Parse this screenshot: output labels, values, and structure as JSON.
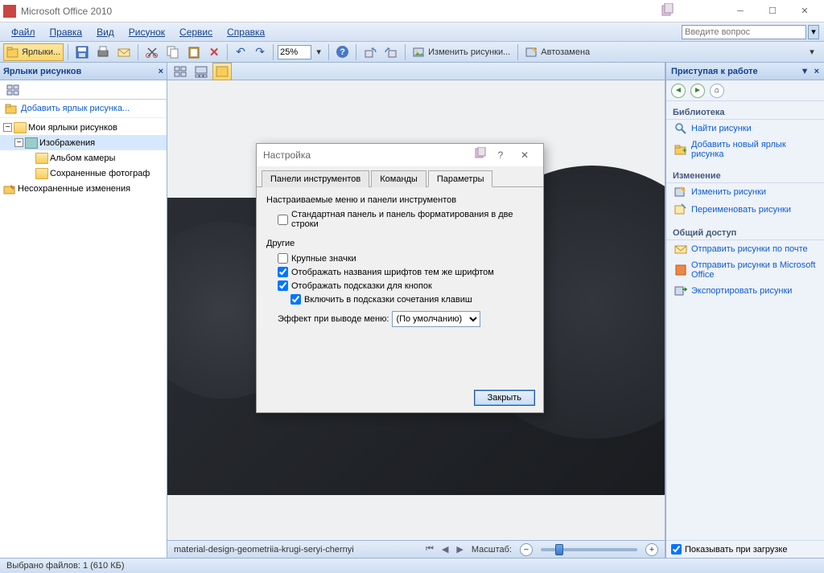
{
  "titlebar": {
    "title": "Microsoft Office 2010"
  },
  "menus": {
    "file": "Файл",
    "edit": "Правка",
    "view": "Вид",
    "picture": "Рисунок",
    "tools": "Сервис",
    "help": "Справка",
    "help_search_placeholder": "Введите вопрос"
  },
  "toolbar": {
    "shortcuts_label": "Ярлыки...",
    "zoom_value": "25%",
    "edit_pictures_label": "Изменить рисунки...",
    "autocorrect_label": "Автозамена"
  },
  "left_panel": {
    "title": "Ярлыки рисунков",
    "add_shortcut": "Добавить ярлык рисунка...",
    "tree": {
      "my_shortcuts": "Мои ярлыки рисунков",
      "images": "Изображения",
      "camera_album": "Альбом камеры",
      "saved_photos": "Сохраненные фотограф",
      "unsaved_changes": "Несохраненные изменения"
    }
  },
  "center": {
    "filename": "material-design-geometriia-krugi-seryi-chernyi",
    "zoom_label": "Масштаб:"
  },
  "right_panel": {
    "title": "Приступая к работе",
    "sections": {
      "library": "Библиотека",
      "edit": "Изменение",
      "share": "Общий доступ"
    },
    "links": {
      "find_pictures": "Найти рисунки",
      "add_new_shortcut": "Добавить новый ярлык рисунка",
      "edit_pictures": "Изменить рисунки",
      "rename_pictures": "Переименовать рисунки",
      "send_email": "Отправить рисунки по почте",
      "send_office": "Отправить рисунки в Microsoft Office",
      "export": "Экспортировать рисунки"
    },
    "show_on_load": "Показывать при загрузке"
  },
  "statusbar": {
    "selected": "Выбрано файлов: 1 (610 КБ)"
  },
  "dialog": {
    "title": "Настройка",
    "tabs": {
      "toolbars": "Панели инструментов",
      "commands": "Команды",
      "options": "Параметры"
    },
    "body": {
      "group1_title": "Настраиваемые меню и панели инструментов",
      "chk_standard": "Стандартная панель и панель форматирования в две строки",
      "group2_title": "Другие",
      "chk_large_icons": "Крупные значки",
      "chk_font_names": "Отображать названия шрифтов тем же шрифтом",
      "chk_tooltips": "Отображать подсказки для кнопок",
      "chk_shortcuts": "Включить в подсказки сочетания клавиш",
      "menu_effect_label": "Эффект при выводе меню:",
      "menu_effect_value": "(По умолчанию)"
    },
    "close_button": "Закрыть"
  }
}
